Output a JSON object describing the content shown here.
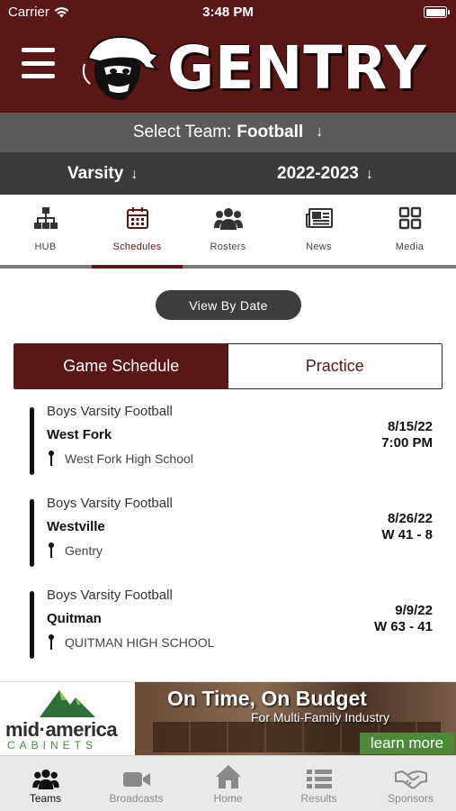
{
  "status": {
    "carrier": "Carrier",
    "time": "3:48 PM"
  },
  "brand": {
    "name": "GENTRY"
  },
  "team_select": {
    "label": "Select Team:",
    "value": "Football"
  },
  "filters": {
    "level": "Varsity",
    "season": "2022-2023"
  },
  "tabs": [
    {
      "label": "HUB",
      "icon": "hierarchy-icon"
    },
    {
      "label": "Schedules",
      "icon": "calendar-icon"
    },
    {
      "label": "Rosters",
      "icon": "group-icon"
    },
    {
      "label": "News",
      "icon": "newspaper-icon"
    },
    {
      "label": "Media",
      "icon": "grid-icon"
    }
  ],
  "view_by_date": "View By Date",
  "segments": {
    "game": "Game Schedule",
    "practice": "Practice"
  },
  "games": [
    {
      "level": "Boys Varsity Football",
      "opponent": "West Fork",
      "location": "West Fork High School",
      "date": "8/15/22",
      "result": "7:00 PM"
    },
    {
      "level": "Boys Varsity Football",
      "opponent": "Westville",
      "location": "Gentry",
      "date": "8/26/22",
      "result": "W 41 - 8"
    },
    {
      "level": "Boys Varsity Football",
      "opponent": "Quitman",
      "location": "QUITMAN HIGH SCHOOL",
      "date": "9/9/22",
      "result": "W 63 - 41"
    }
  ],
  "ad": {
    "brand_top": "mid·america",
    "brand_bottom": "CABINETS",
    "headline": "On Time, On Budget",
    "subline": "For Multi-Family Industry",
    "cta": "learn more"
  },
  "bottom_nav": [
    {
      "label": "Teams",
      "icon": "team-icon"
    },
    {
      "label": "Broadcasts",
      "icon": "video-camera-icon"
    },
    {
      "label": "Home",
      "icon": "home-icon"
    },
    {
      "label": "Results",
      "icon": "list-icon"
    },
    {
      "label": "Sponsors",
      "icon": "handshake-icon"
    }
  ],
  "colors": {
    "brand": "#5a1716",
    "dark_gray": "#3b3b3b",
    "mid_gray": "#5b5b5b",
    "ad_green": "#4c8a3a"
  }
}
